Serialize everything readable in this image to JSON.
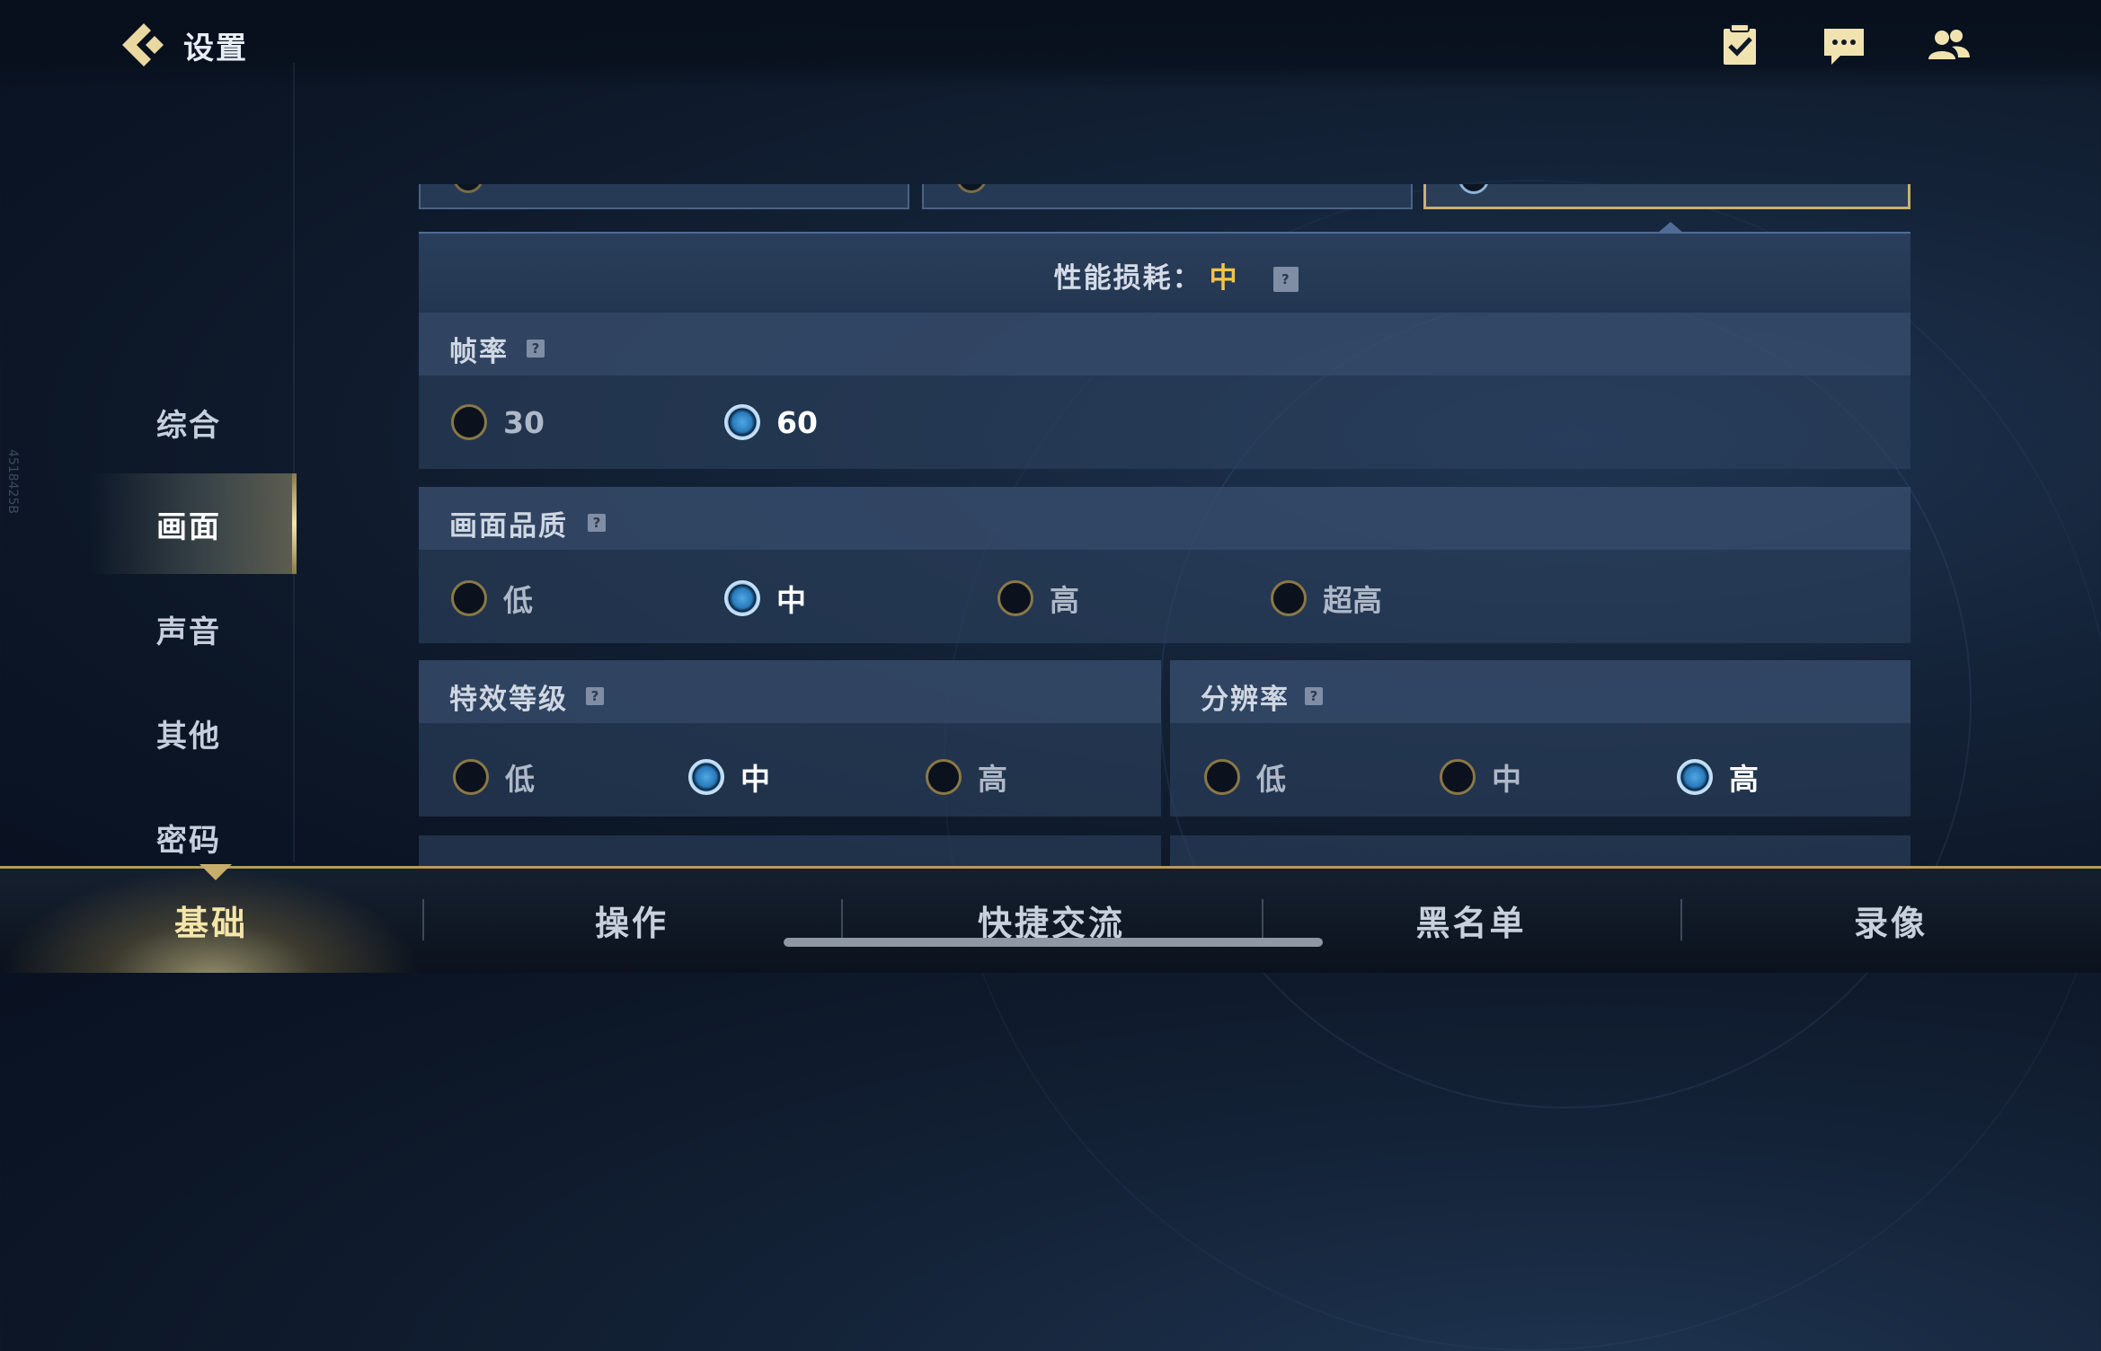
{
  "header": {
    "title": "设置",
    "icons": [
      "back-arrow-icon",
      "clipboard-check-icon",
      "chat-icon",
      "friends-icon"
    ]
  },
  "sidebar": {
    "items": [
      {
        "label": "综合",
        "active": false
      },
      {
        "label": "画面",
        "active": true
      },
      {
        "label": "声音",
        "active": false
      },
      {
        "label": "其他",
        "active": false
      },
      {
        "label": "密码",
        "active": false
      }
    ],
    "watermark": "4518425B"
  },
  "performance": {
    "label": "性能损耗：",
    "value": "中",
    "help": "?"
  },
  "frame_rate": {
    "title": "帧率",
    "help": "?",
    "options": [
      {
        "label": "30",
        "selected": false
      },
      {
        "label": "60",
        "selected": true
      }
    ]
  },
  "quality": {
    "title": "画面品质",
    "help": "?",
    "options": [
      {
        "label": "低",
        "selected": false
      },
      {
        "label": "中",
        "selected": true
      },
      {
        "label": "高",
        "selected": false
      },
      {
        "label": "超高",
        "selected": false
      }
    ]
  },
  "effects": {
    "title": "特效等级",
    "help": "?",
    "options": [
      {
        "label": "低",
        "selected": false
      },
      {
        "label": "中",
        "selected": true
      },
      {
        "label": "高",
        "selected": false
      }
    ]
  },
  "resolution": {
    "title": "分辨率",
    "help": "?",
    "options": [
      {
        "label": "低",
        "selected": false
      },
      {
        "label": "中",
        "selected": false
      },
      {
        "label": "高",
        "selected": true
      }
    ]
  },
  "tabs": [
    {
      "label": "基础",
      "active": true
    },
    {
      "label": "操作",
      "active": false
    },
    {
      "label": "快捷交流",
      "active": false
    },
    {
      "label": "黑名单",
      "active": false
    },
    {
      "label": "录像",
      "active": false
    }
  ],
  "colors": {
    "accent_gold": "#c9b071",
    "perf_value": "#f5c44a",
    "radio_on": "#4fa7e0"
  }
}
